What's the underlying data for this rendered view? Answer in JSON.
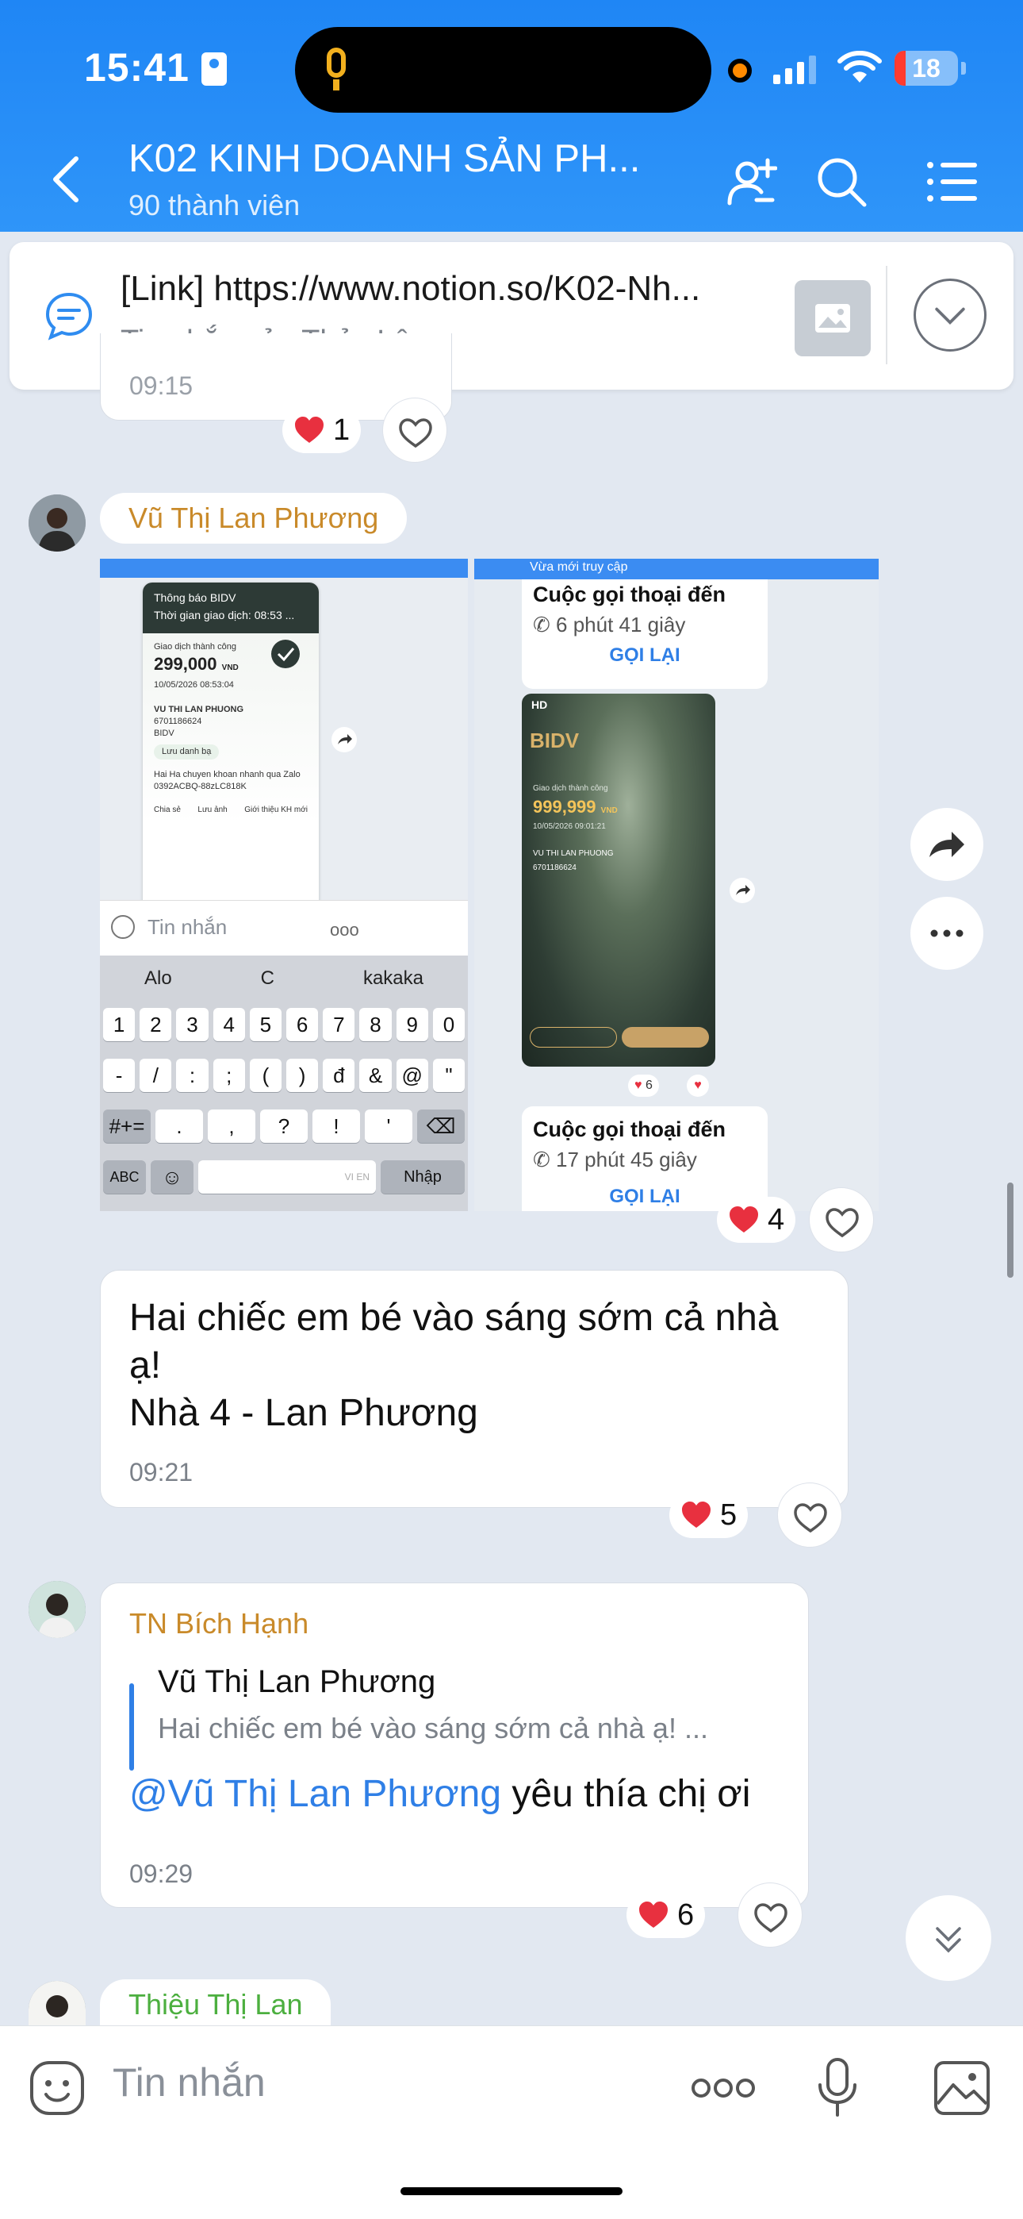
{
  "status_bar": {
    "time": "15:41",
    "battery": "18",
    "battery_level": 0.18
  },
  "header": {
    "title": "K02 KINH DOANH SẢN PH...",
    "subtitle": "90 thành viên"
  },
  "pinned": {
    "link": "[Link] https://www.notion.so/K02-Nh...",
    "sub": "Tin nhắn của Thủy Lê"
  },
  "top_reaction": {
    "count": "1",
    "partial_time": "09:15"
  },
  "messages": [
    {
      "sender": "Vũ Thị Lan Phương",
      "reaction": "4",
      "screenshot_left": {
        "notif_title": "Thông báo BIDV",
        "notif_time": "Thời gian giao dịch: 08:53 ...",
        "success": "Giao dịch thành công",
        "amount": "299,000",
        "currency": "VND",
        "datetime": "10/05/2026 08:53:04",
        "to": "VU THI LAN PHUONG",
        "account": "6701186624",
        "bank": "BIDV",
        "save_contact": "Lưu danh bạ",
        "memo": "Hai Ha chuyen khoan nhanh qua Zalo",
        "ref": "0392ACBQ-88zLC818K",
        "share": "Chia sẻ",
        "save_img": "Lưu ảnh",
        "intro": "Giới thiệu KH mới",
        "input_placeholder": "Tin nhắn",
        "suggestions": [
          "Alo",
          "C",
          "kakaka"
        ],
        "row1": [
          "1",
          "2",
          "3",
          "4",
          "5",
          "6",
          "7",
          "8",
          "9",
          "0"
        ],
        "row2": [
          "-",
          "/",
          ":",
          ";",
          "(",
          ")",
          "đ",
          "&",
          "@",
          "\""
        ],
        "row3": [
          "#+=",
          ".",
          ",",
          "?",
          "!",
          "'",
          "⌫"
        ],
        "abc": "ABC",
        "enter": "Nhập",
        "space_hint": "VI EN"
      },
      "screenshot_right": {
        "top_hint": "Vừa mới truy cập",
        "call1_title": "Cuộc gọi thoại đến",
        "call1_dur": "6 phút 41 giây",
        "call1_btn": "GỌI LẠI",
        "hd": "HD",
        "bank": "BIDV",
        "success": "Giao dịch thành công",
        "amount": "999,999",
        "currency": "VND",
        "datetime": "10/05/2026 09:01:21",
        "to": "VU THI LAN PHUONG",
        "account": "6701186624",
        "mini_reaction": "6",
        "call2_title": "Cuộc gọi thoại đến",
        "call2_dur": "17 phút 45 giây",
        "call2_btn": "GỌI LẠI"
      }
    },
    {
      "text_line1": "Hai chiếc em bé vào sáng sớm cả nhà",
      "text_line2": "ạ!",
      "text_line3": "Nhà 4 - Lan Phương",
      "time": "09:21",
      "reaction": "5"
    },
    {
      "sender": "TN Bích Hạnh",
      "quote_name": "Vũ Thị Lan Phương",
      "quote_text": "Hai chiếc em bé vào sáng sớm cả nhà ạ! ...",
      "mention": "@Vũ Thị Lan Phương",
      "text": " yêu thía chị ơi",
      "time": "09:29",
      "reaction": "6"
    },
    {
      "sender": "Thiệu Thị Lan"
    }
  ],
  "composer": {
    "placeholder": "Tin nhắn"
  },
  "colors": {
    "header_blue": "#1f86f5",
    "name_orange": "#c98a2a",
    "name_green": "#4caf3f",
    "link_blue": "#2f7fe6",
    "heart_red": "#e8303f"
  }
}
